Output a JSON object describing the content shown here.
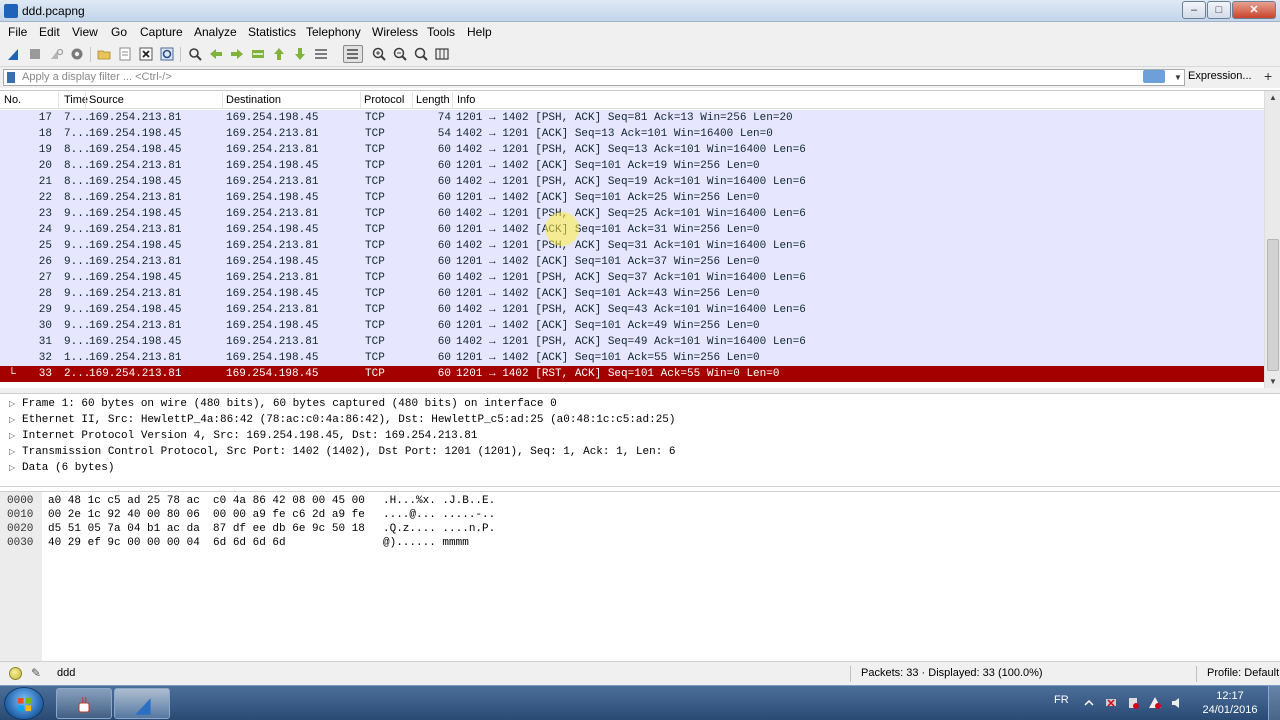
{
  "window": {
    "title": "ddd.pcapng"
  },
  "menu": [
    "File",
    "Edit",
    "View",
    "Go",
    "Capture",
    "Analyze",
    "Statistics",
    "Telephony",
    "Wireless",
    "Tools",
    "Help"
  ],
  "toolbar": {
    "icons": [
      "shark-fin-start-icon",
      "stop-icon",
      "restart-icon",
      "options-gear-icon",
      "open-folder-icon",
      "open-recent-icon",
      "close-file-icon",
      "reload-icon",
      "find-icon",
      "back-arrow-icon",
      "forward-arrow-icon",
      "go-to-packet-icon",
      "first-packet-icon",
      "last-packet-icon",
      "autoscroll-icon",
      "colorize-icon",
      "zoom-in-icon",
      "zoom-out-icon",
      "normal-size-icon",
      "resize-columns-icon"
    ]
  },
  "filter": {
    "placeholder": "Apply a display filter ... <Ctrl-/>",
    "expression_label": "Expression...",
    "plus_label": "+"
  },
  "packet_list": {
    "columns": [
      "No.",
      "Time",
      "Source",
      "Destination",
      "Protocol",
      "Length",
      "Info"
    ],
    "rows": [
      {
        "no": "17",
        "time": "7...",
        "src": "169.254.213.81",
        "dst": "169.254.198.45",
        "proto": "TCP",
        "len": "74",
        "info": "1201 → 1402 [PSH, ACK] Seq=81 Ack=13 Win=256 Len=20"
      },
      {
        "no": "18",
        "time": "7...",
        "src": "169.254.198.45",
        "dst": "169.254.213.81",
        "proto": "TCP",
        "len": "54",
        "info": "1402 → 1201 [ACK] Seq=13 Ack=101 Win=16400 Len=0"
      },
      {
        "no": "19",
        "time": "8...",
        "src": "169.254.198.45",
        "dst": "169.254.213.81",
        "proto": "TCP",
        "len": "60",
        "info": "1402 → 1201 [PSH, ACK] Seq=13 Ack=101 Win=16400 Len=6"
      },
      {
        "no": "20",
        "time": "8...",
        "src": "169.254.213.81",
        "dst": "169.254.198.45",
        "proto": "TCP",
        "len": "60",
        "info": "1201 → 1402 [ACK] Seq=101 Ack=19 Win=256 Len=0"
      },
      {
        "no": "21",
        "time": "8...",
        "src": "169.254.198.45",
        "dst": "169.254.213.81",
        "proto": "TCP",
        "len": "60",
        "info": "1402 → 1201 [PSH, ACK] Seq=19 Ack=101 Win=16400 Len=6"
      },
      {
        "no": "22",
        "time": "8...",
        "src": "169.254.213.81",
        "dst": "169.254.198.45",
        "proto": "TCP",
        "len": "60",
        "info": "1201 → 1402 [ACK] Seq=101 Ack=25 Win=256 Len=0"
      },
      {
        "no": "23",
        "time": "9...",
        "src": "169.254.198.45",
        "dst": "169.254.213.81",
        "proto": "TCP",
        "len": "60",
        "info": "1402 → 1201 [PSH, ACK] Seq=25 Ack=101 Win=16400 Len=6"
      },
      {
        "no": "24",
        "time": "9...",
        "src": "169.254.213.81",
        "dst": "169.254.198.45",
        "proto": "TCP",
        "len": "60",
        "info": "1201 → 1402 [ACK] Seq=101 Ack=31 Win=256 Len=0"
      },
      {
        "no": "25",
        "time": "9...",
        "src": "169.254.198.45",
        "dst": "169.254.213.81",
        "proto": "TCP",
        "len": "60",
        "info": "1402 → 1201 [PSH, ACK] Seq=31 Ack=101 Win=16400 Len=6"
      },
      {
        "no": "26",
        "time": "9...",
        "src": "169.254.213.81",
        "dst": "169.254.198.45",
        "proto": "TCP",
        "len": "60",
        "info": "1201 → 1402 [ACK] Seq=101 Ack=37 Win=256 Len=0"
      },
      {
        "no": "27",
        "time": "9...",
        "src": "169.254.198.45",
        "dst": "169.254.213.81",
        "proto": "TCP",
        "len": "60",
        "info": "1402 → 1201 [PSH, ACK] Seq=37 Ack=101 Win=16400 Len=6"
      },
      {
        "no": "28",
        "time": "9...",
        "src": "169.254.213.81",
        "dst": "169.254.198.45",
        "proto": "TCP",
        "len": "60",
        "info": "1201 → 1402 [ACK] Seq=101 Ack=43 Win=256 Len=0"
      },
      {
        "no": "29",
        "time": "9...",
        "src": "169.254.198.45",
        "dst": "169.254.213.81",
        "proto": "TCP",
        "len": "60",
        "info": "1402 → 1201 [PSH, ACK] Seq=43 Ack=101 Win=16400 Len=6"
      },
      {
        "no": "30",
        "time": "9...",
        "src": "169.254.213.81",
        "dst": "169.254.198.45",
        "proto": "TCP",
        "len": "60",
        "info": "1201 → 1402 [ACK] Seq=101 Ack=49 Win=256 Len=0"
      },
      {
        "no": "31",
        "time": "9...",
        "src": "169.254.198.45",
        "dst": "169.254.213.81",
        "proto": "TCP",
        "len": "60",
        "info": "1402 → 1201 [PSH, ACK] Seq=49 Ack=101 Win=16400 Len=6"
      },
      {
        "no": "32",
        "time": "1...",
        "src": "169.254.213.81",
        "dst": "169.254.198.45",
        "proto": "TCP",
        "len": "60",
        "info": "1201 → 1402 [ACK] Seq=101 Ack=55 Win=256 Len=0"
      },
      {
        "no": "33",
        "time": "2...",
        "src": "169.254.213.81",
        "dst": "169.254.198.45",
        "proto": "TCP",
        "len": "60",
        "info": "1201 → 1402 [RST, ACK] Seq=101 Ack=55 Win=0 Len=0",
        "selected": true
      }
    ]
  },
  "details": [
    "Frame 1: 60 bytes on wire (480 bits), 60 bytes captured (480 bits) on interface 0",
    "Ethernet II, Src: HewlettP_4a:86:42 (78:ac:c0:4a:86:42), Dst: HewlettP_c5:ad:25 (a0:48:1c:c5:ad:25)",
    "Internet Protocol Version 4, Src: 169.254.198.45, Dst: 169.254.213.81",
    "Transmission Control Protocol, Src Port: 1402 (1402), Dst Port: 1201 (1201), Seq: 1, Ack: 1, Len: 6",
    "Data (6 bytes)"
  ],
  "bytes": [
    {
      "offset": "0000",
      "hex": "a0 48 1c c5 ad 25 78 ac  c0 4a 86 42 08 00 45 00",
      "ascii": ".H...%x. .J.B..E."
    },
    {
      "offset": "0010",
      "hex": "00 2e 1c 92 40 00 80 06  00 00 a9 fe c6 2d a9 fe",
      "ascii": "....@... .....-.."
    },
    {
      "offset": "0020",
      "hex": "d5 51 05 7a 04 b1 ac da  87 df ee db 6e 9c 50 18",
      "ascii": ".Q.z.... ....n.P."
    },
    {
      "offset": "0030",
      "hex": "40 29 ef 9c 00 00 00 04  6d 6d 6d 6d",
      "ascii": "@)...... mmmm"
    }
  ],
  "status": {
    "file": "ddd",
    "packets": "Packets: 33 · Displayed: 33 (100.0%)",
    "profile": "Profile: Default"
  },
  "taskbar": {
    "lang": "FR",
    "time": "12:17",
    "date": "24/01/2016"
  },
  "colors": {
    "row_bg": "#e7e6ff",
    "selected_bg": "#a40000",
    "selected_fg": "#ffffff"
  }
}
